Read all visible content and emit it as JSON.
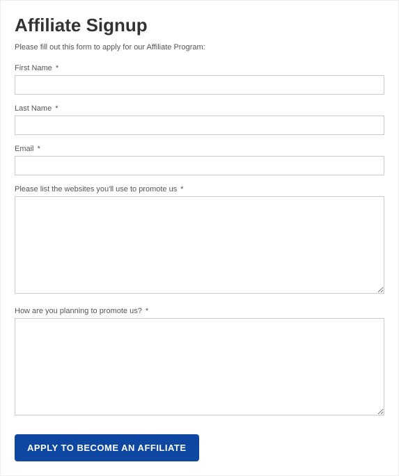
{
  "page": {
    "title": "Affiliate Signup",
    "instructions": "Please fill out this form to apply for our Affiliate Program:"
  },
  "form": {
    "first_name": {
      "label": "First Name",
      "required_mark": "*",
      "value": ""
    },
    "last_name": {
      "label": "Last Name",
      "required_mark": "*",
      "value": ""
    },
    "email": {
      "label": "Email",
      "required_mark": "*",
      "value": ""
    },
    "websites": {
      "label": "Please list the websites you'll use to promote us",
      "required_mark": "*",
      "value": ""
    },
    "plan": {
      "label": "How are you planning to promote us?",
      "required_mark": "*",
      "value": ""
    },
    "submit_label": "APPLY TO BECOME AN AFFILIATE"
  }
}
